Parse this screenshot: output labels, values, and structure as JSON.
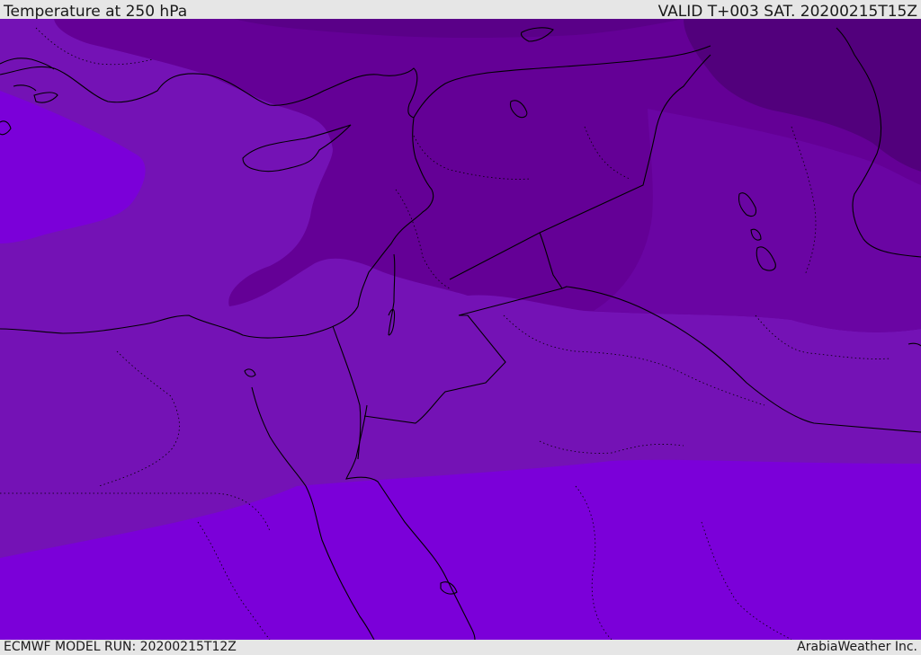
{
  "header": {
    "title": "Temperature at 250 hPa",
    "valid": "VALID T+003 SAT. 20200215T15Z"
  },
  "footer": {
    "model_run": "ECMWF MODEL RUN: 20200215T12Z",
    "credit": "ArabiaWeather Inc."
  },
  "map": {
    "variable": "Temperature",
    "level": "250 hPa",
    "palette": {
      "warmest": "#7b00d9",
      "warm": "#7412b5",
      "mid": "#6a05a3",
      "cool": "#640096",
      "coldest": "#52007c",
      "coastline": "#000000"
    }
  }
}
